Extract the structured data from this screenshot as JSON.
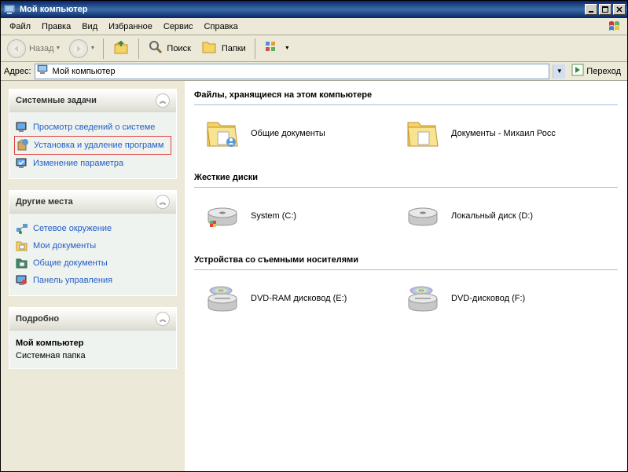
{
  "title": "Мой компьютер",
  "menu": [
    "Файл",
    "Правка",
    "Вид",
    "Избранное",
    "Сервис",
    "Справка"
  ],
  "toolbar": {
    "back": "Назад",
    "search": "Поиск",
    "folders": "Папки"
  },
  "address": {
    "label": "Адрес:",
    "value": "Мой компьютер",
    "go": "Переход"
  },
  "panels": {
    "system_tasks": {
      "title": "Системные задачи",
      "items": [
        "Просмотр сведений о системе",
        "Установка и удаление программ",
        "Изменение параметра"
      ]
    },
    "other_places": {
      "title": "Другие места",
      "items": [
        "Сетевое окружение",
        "Мои документы",
        "Общие документы",
        "Панель управления"
      ]
    },
    "details": {
      "title": "Подробно",
      "name": "Мой компьютер",
      "type": "Системная папка"
    }
  },
  "sections": {
    "files": {
      "header": "Файлы, хранящиеся на этом компьютере",
      "items": [
        "Общие документы",
        "Документы - Михаил Росс"
      ]
    },
    "disks": {
      "header": "Жесткие диски",
      "items": [
        "System (C:)",
        "Локальный диск (D:)"
      ]
    },
    "removable": {
      "header": "Устройства со съемными носителями",
      "items": [
        "DVD-RAM дисковод (E:)",
        "DVD-дисковод (F:)"
      ]
    }
  }
}
